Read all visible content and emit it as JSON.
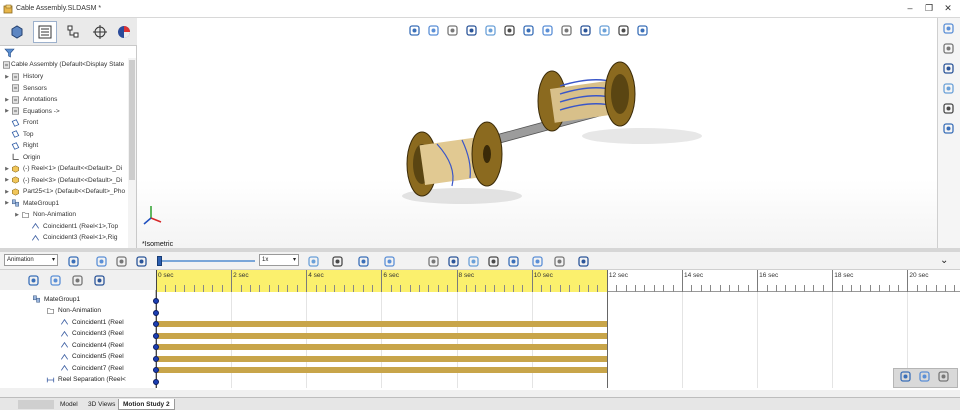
{
  "window": {
    "title": "Cable Assembly.SLDASM *",
    "controls": [
      "minimize",
      "restore",
      "close"
    ]
  },
  "feature_tree": {
    "root": "Cable Assembly  (Default<Display State",
    "items": [
      {
        "label": "History",
        "icon": "history-icon",
        "expand": true
      },
      {
        "label": "Sensors",
        "icon": "sensor-icon",
        "expand": false
      },
      {
        "label": "Annotations",
        "icon": "annotations-icon",
        "expand": true
      },
      {
        "label": "Equations ->",
        "icon": "equations-icon",
        "expand": true
      },
      {
        "label": "Front",
        "icon": "plane-icon",
        "expand": false
      },
      {
        "label": "Top",
        "icon": "plane-icon",
        "expand": false
      },
      {
        "label": "Right",
        "icon": "plane-icon",
        "expand": false
      },
      {
        "label": "Origin",
        "icon": "origin-icon",
        "expand": false
      },
      {
        "label": "(-) Reel<1> (Default<<Default>_Di",
        "icon": "part-icon",
        "expand": true
      },
      {
        "label": "(-) Reel<3> (Default<<Default>_Di",
        "icon": "part-icon",
        "expand": true
      },
      {
        "label": "Part25<1> (Default<<Default>_Pho",
        "icon": "part-icon",
        "expand": true
      },
      {
        "label": "MateGroup1",
        "icon": "mates-icon",
        "expand": true
      },
      {
        "label": "Non-Animation",
        "icon": "folder-icon",
        "expand": true,
        "indent": 1
      },
      {
        "label": "Coincident1 (Reel<1>,Top",
        "icon": "coincident-icon",
        "expand": false,
        "indent": 2
      },
      {
        "label": "Coincident3 (Reel<1>,Rig",
        "icon": "coincident-icon",
        "expand": false,
        "indent": 2
      }
    ]
  },
  "heads_up_toolbar": [
    "rotate-icon",
    "redo-view-icon",
    "zoom-fit-icon",
    "zoom-area-icon",
    "previous-view-icon",
    "section-view-icon",
    "dynamic-annotation-icon",
    "view-orientation-icon",
    "display-style-icon",
    "hide-show-icon",
    "edit-appearance-icon",
    "apply-scene-icon",
    "view-settings-icon"
  ],
  "viewport": {
    "view_label": "*Isometric"
  },
  "task_pane": [
    "home-icon",
    "design-library-icon",
    "file-explorer-icon",
    "view-palette-icon",
    "appearances-icon",
    "custom-properties-icon"
  ],
  "motion_toolbar": {
    "study_type": "Animation",
    "playback_speed": "1x",
    "buttons": [
      "calculate-icon",
      "play-from-start-icon",
      "play-icon",
      "stop-icon",
      "autokey-icon",
      "add-key-icon",
      "motion-study-properties-icon",
      "motor-icon",
      "spring-icon",
      "damper-icon",
      "force-icon",
      "contact-icon",
      "gravity-icon",
      "results-icon",
      "export-icon",
      "settings-icon"
    ]
  },
  "motion_tree": {
    "filter_buttons": [
      "filter-animated-icon",
      "filter-driving-icon",
      "filter-selected-icon",
      "filter-results-icon"
    ],
    "items": [
      {
        "label": "MateGroup1",
        "icon": "mates-icon",
        "indent": 0
      },
      {
        "label": "Non-Animation",
        "icon": "folder-icon",
        "indent": 1
      },
      {
        "label": "Coincident1 (Reel",
        "icon": "coincident-icon",
        "indent": 2
      },
      {
        "label": "Coincident3 (Reel",
        "icon": "coincident-icon",
        "indent": 2
      },
      {
        "label": "Coincident4 (Reel",
        "icon": "coincident-icon",
        "indent": 2
      },
      {
        "label": "Coincident5 (Reel",
        "icon": "coincident-icon",
        "indent": 2
      },
      {
        "label": "Coincident7 (Reel",
        "icon": "coincident-icon",
        "indent": 2
      },
      {
        "label": "Reel Separation (Reel<",
        "icon": "distance-icon",
        "indent": 1
      }
    ]
  },
  "timeline": {
    "ticks": [
      "0 sec",
      "2 sec",
      "4 sec",
      "6 sec",
      "8 sec",
      "10 sec",
      "12 sec",
      "14 sec",
      "16 sec",
      "18 sec",
      "20 sec"
    ],
    "duration_sec": 12,
    "tick_step_sec": 2,
    "max_sec": 21.4,
    "colors": {
      "ruler_active": "#fbf06d",
      "bar": "#c8a54a",
      "key": "#1c3fb3"
    },
    "bar_rows": [
      2,
      3,
      4,
      5,
      6
    ]
  },
  "bottom_tabs": [
    {
      "label": "Model",
      "active": false
    },
    {
      "label": "3D Views",
      "active": false
    },
    {
      "label": "Motion Study 2",
      "active": true
    }
  ],
  "zoom_controls": [
    "zoom-in-timeline-icon",
    "zoom-out-timeline-icon",
    "zoom-fit-timeline-icon"
  ]
}
